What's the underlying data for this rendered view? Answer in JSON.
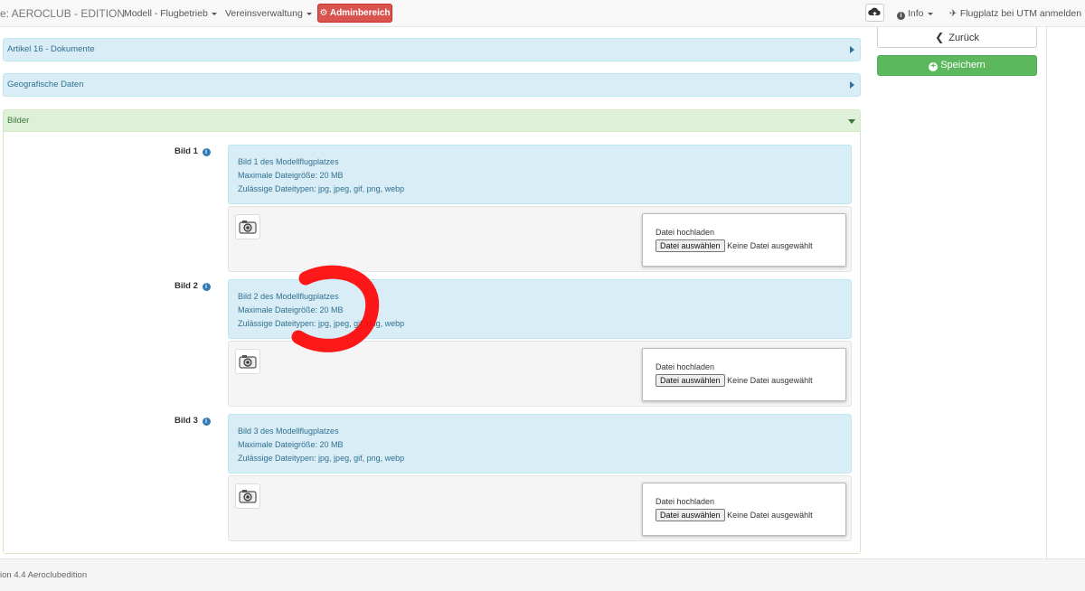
{
  "navbar": {
    "brand": "e: AEROCLUB - EDITION",
    "menu_modell": "Modell - Flugbetrieb",
    "menu_verein": "Vereinsverwaltung",
    "admin_label": "Adminbereich",
    "info_label": "Info",
    "utm_label": "Flugplatz bei UTM anmelden"
  },
  "sections": {
    "artikel16": "Artikel 16 - Dokumente",
    "geo": "Geografische Daten",
    "bilder": "Bilder"
  },
  "images": [
    {
      "label": "Bild 1",
      "description": "Bild 1 des Modellflugplatzes",
      "max_size": "Maximale Dateigröße: 20 MB",
      "types": "Zulässige Dateitypen: jpg, jpeg, gif, png, webp",
      "upload_title": "Datei hochladen",
      "choose_btn": "Datei auswählen",
      "no_file": "Keine Datei ausgewählt"
    },
    {
      "label": "Bild 2",
      "description": "Bild 2 des Modellflugplatzes",
      "max_size": "Maximale Dateigröße: 20 MB",
      "types": "Zulässige Dateitypen: jpg, jpeg, gif, png, webp",
      "upload_title": "Datei hochladen",
      "choose_btn": "Datei auswählen",
      "no_file": "Keine Datei ausgewählt"
    },
    {
      "label": "Bild 3",
      "description": "Bild 3 des Modellflugplatzes",
      "max_size": "Maximale Dateigröße: 20 MB",
      "types": "Zulässige Dateitypen: jpg, jpeg, gif, png, webp",
      "upload_title": "Datei hochladen",
      "choose_btn": "Datei auswählen",
      "no_file": "Keine Datei ausgewählt"
    }
  ],
  "sidebar": {
    "back_label": "Zurück",
    "save_label": "Speichern"
  },
  "footer": {
    "text": "ion 4.4 Aeroclubedition"
  },
  "colors": {
    "admin_red": "#d9534f",
    "save_green": "#5cb85c",
    "info_blue_bg": "#d9edf7",
    "success_bg": "#dff0d8",
    "annotation_red": "#ff0000"
  }
}
